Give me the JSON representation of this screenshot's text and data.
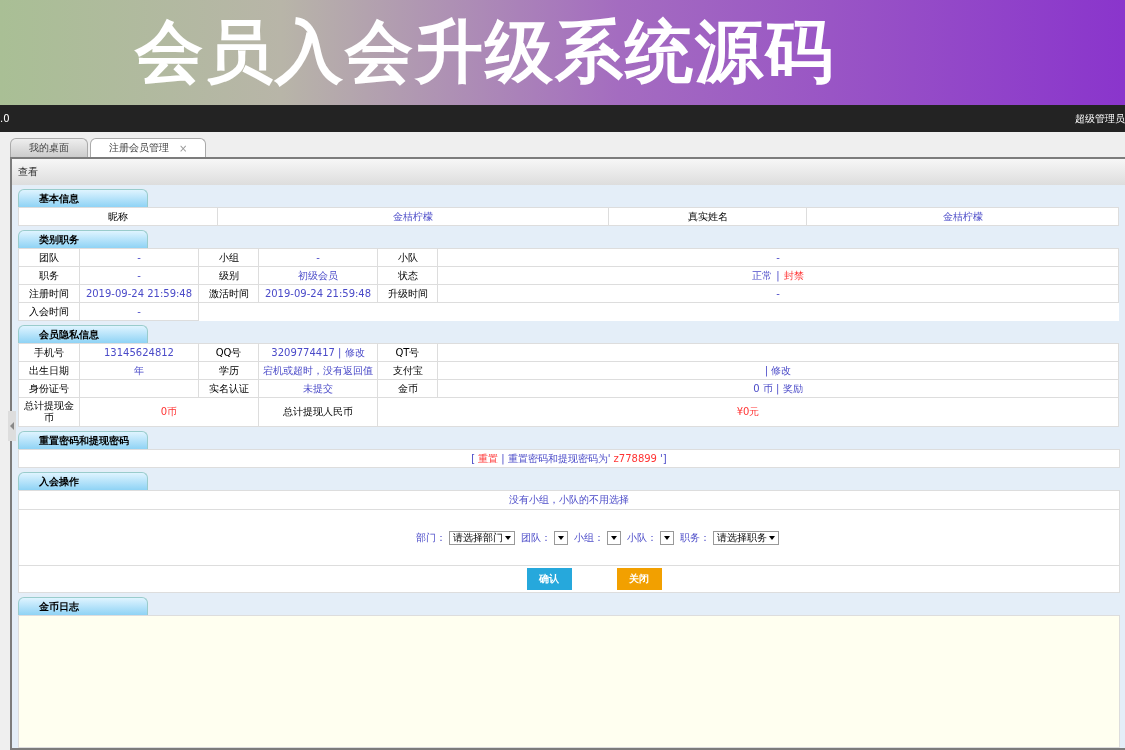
{
  "banner": {
    "title": "会员入会升级系统源码"
  },
  "topbar": {
    "version": ".0",
    "user": "超级管理员"
  },
  "tabs": [
    {
      "label": "我的桌面",
      "selected": false
    },
    {
      "label": "注册会员管理",
      "selected": true,
      "close": "×"
    }
  ],
  "panel": {
    "title": "查看"
  },
  "sections": [
    {
      "kind": "table",
      "title": "基本信息",
      "rows": [
        [
          {
            "kind": "label",
            "text": "昵称"
          },
          {
            "kind": "value",
            "text": "金桔柠檬",
            "alert": false
          },
          {
            "kind": "label",
            "text": "真实姓名"
          },
          {
            "kind": "value",
            "text": "金桔柠檬",
            "alert": false
          }
        ]
      ]
    },
    {
      "kind": "table",
      "title": "类别职务",
      "rows": [
        [
          {
            "kind": "label",
            "text": "团队"
          },
          {
            "kind": "value",
            "text": "-",
            "alert": false
          },
          {
            "kind": "label",
            "text": "小组"
          },
          {
            "kind": "value",
            "text": "-",
            "alert": false
          },
          {
            "kind": "label",
            "text": "小队"
          },
          {
            "kind": "value",
            "text": "-",
            "alert": false
          }
        ],
        [
          {
            "kind": "label",
            "text": "职务"
          },
          {
            "kind": "value",
            "text": "-",
            "alert": false
          },
          {
            "kind": "label",
            "text": "级别"
          },
          {
            "kind": "value",
            "text": "初级会员",
            "alert": false
          },
          {
            "kind": "label",
            "text": "状态"
          },
          {
            "kind": "value",
            "parts": [
              {
                "text": "正常",
                "alert": false
              },
              {
                "text": "|",
                "alert": false
              },
              {
                "text": "封禁",
                "alert": true
              }
            ]
          }
        ],
        [
          {
            "kind": "label",
            "text": "注册时间"
          },
          {
            "kind": "value",
            "text": "2019-09-24 21:59:48",
            "alert": false
          },
          {
            "kind": "label",
            "text": "激活时间"
          },
          {
            "kind": "value",
            "text": "2019-09-24 21:59:48",
            "alert": false
          },
          {
            "kind": "label",
            "text": "升级时间"
          },
          {
            "kind": "value",
            "text": "-",
            "alert": false
          }
        ],
        [
          {
            "kind": "label",
            "text": "入会时间"
          },
          {
            "kind": "value",
            "text": "-",
            "alert": false
          }
        ]
      ]
    },
    {
      "kind": "table",
      "title": "会员隐私信息",
      "rows": [
        [
          {
            "kind": "label",
            "text": "手机号"
          },
          {
            "kind": "value",
            "text": "13145624812",
            "alert": false
          },
          {
            "kind": "label",
            "text": "QQ号"
          },
          {
            "kind": "value",
            "text": "3209774417 | 修改",
            "alert": false
          },
          {
            "kind": "label",
            "text": "QT号"
          },
          {
            "kind": "value"
          }
        ],
        [
          {
            "kind": "label",
            "text": "出生日期"
          },
          {
            "kind": "value",
            "text": "年",
            "alert": false
          },
          {
            "kind": "label",
            "text": "学历"
          },
          {
            "kind": "value",
            "text": "宕机或超时，没有返回值",
            "alert": false
          },
          {
            "kind": "label",
            "text": "支付宝"
          },
          {
            "kind": "value",
            "text": "| 修改",
            "alert": false
          }
        ],
        [
          {
            "kind": "label",
            "text": "身份证号"
          },
          {
            "kind": "value"
          },
          {
            "kind": "label",
            "text": "实名认证"
          },
          {
            "kind": "value",
            "text": "未提交",
            "alert": false
          },
          {
            "kind": "label",
            "text": "金币"
          },
          {
            "kind": "value",
            "text": "0 币 | 奖励",
            "alert": false
          }
        ]
      ],
      "summary": [
        {
          "kind": "label",
          "text": "总计提现金币"
        },
        {
          "kind": "value",
          "text": "0币",
          "alert": true
        },
        {
          "kind": "label",
          "text": "总计提现人民币"
        },
        {
          "kind": "value",
          "text": "¥0元",
          "alert": true
        }
      ]
    },
    {
      "kind": "line",
      "title": "重置密码和提现密码",
      "parts": [
        {
          "text": "[",
          "alert": false
        },
        {
          "text": "重置",
          "alert": true
        },
        {
          "text": "| 重置密码和提现密码为'",
          "alert": false
        },
        {
          "text": "z778899",
          "alert": true
        },
        {
          "text": "']",
          "alert": false
        }
      ]
    },
    {
      "kind": "form",
      "title": "入会操作",
      "note": "没有小组，小队的不用选择",
      "selects": [
        {
          "label": "部门：",
          "value": "请选择部门"
        },
        {
          "label": "团队："
        },
        {
          "label": "小组："
        },
        {
          "label": "小队："
        },
        {
          "label": "职务：",
          "value": "请选择职务"
        }
      ],
      "buttons": [
        {
          "label": "确认",
          "kind": "primary"
        },
        {
          "label": "关闭",
          "kind": "warning"
        }
      ]
    },
    {
      "kind": "log",
      "title": "金币日志"
    }
  ]
}
